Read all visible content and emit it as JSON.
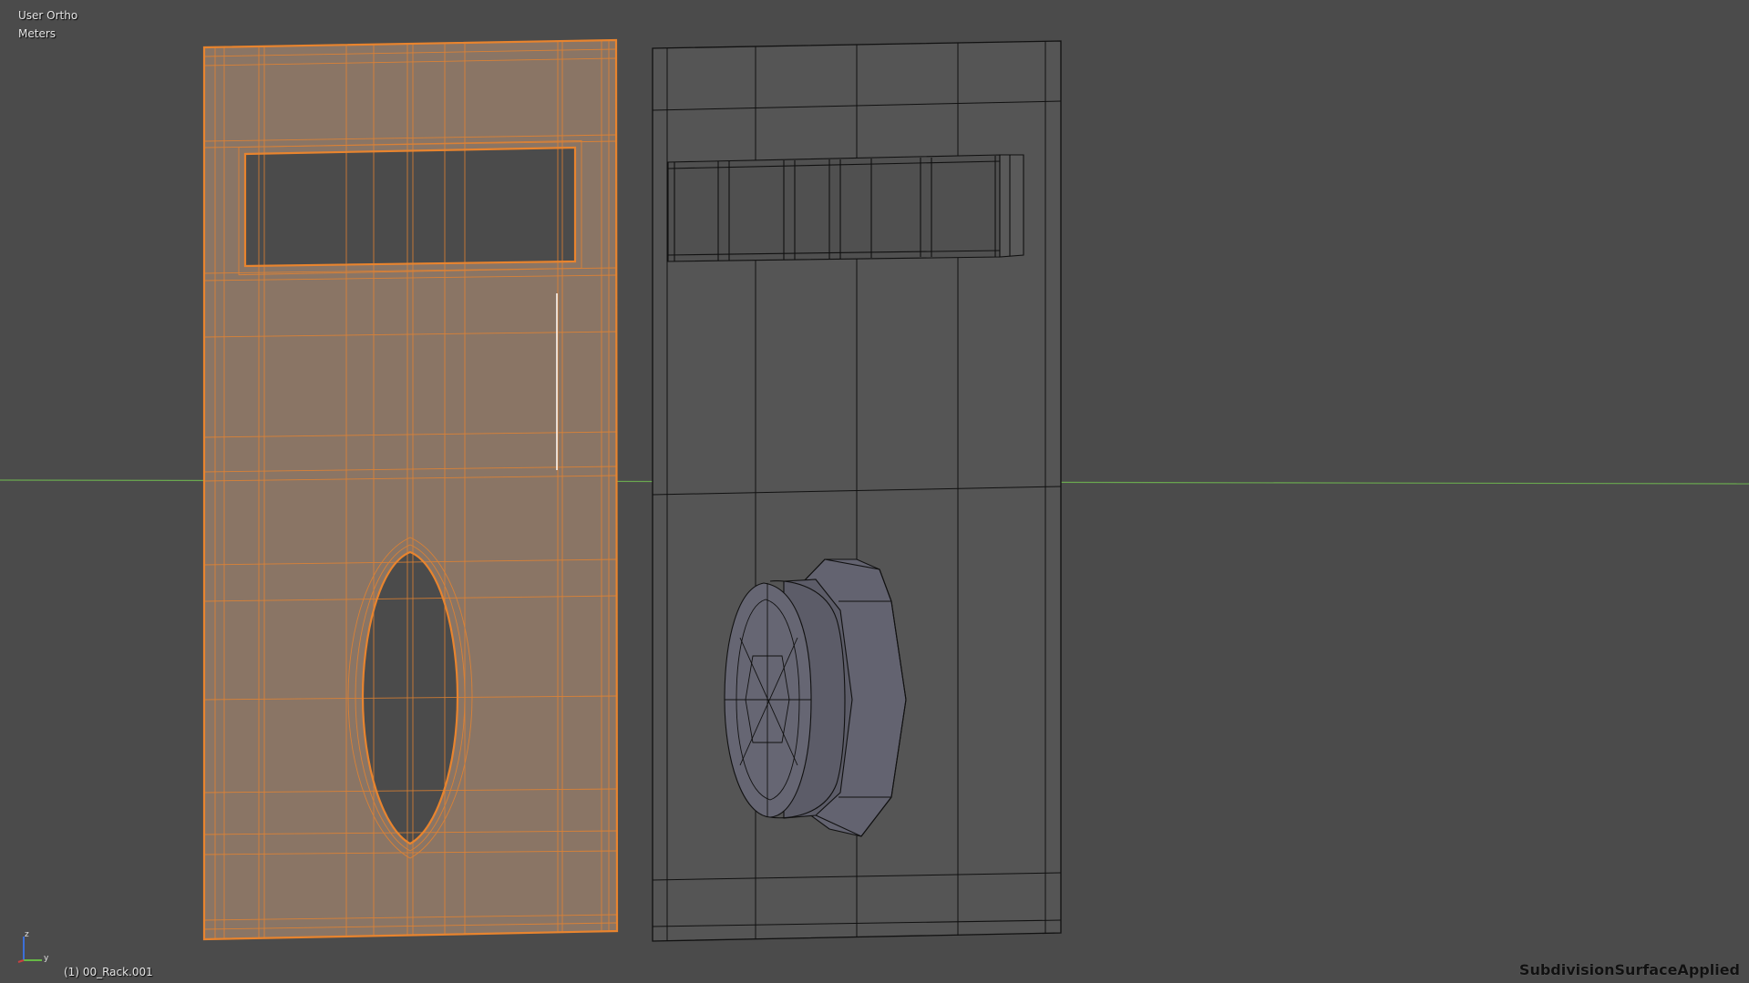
{
  "viewport": {
    "view_type": "User Ortho",
    "units": "Meters",
    "object_info": "(1) 00_Rack.001",
    "modifier_label": "SubdivisionSurfaceApplied"
  },
  "axis_gizmo": {
    "z_label": "z",
    "y_label": "y"
  },
  "colors": {
    "background": "#4b4b4b",
    "selected_wire": "#e8842e",
    "selected_face": "#8a7565",
    "mesh_face": "#555555",
    "mesh_wire": "#111111",
    "horizon_line": "#6aa84f"
  },
  "objects": [
    {
      "name": "selected-panel",
      "selected": true
    },
    {
      "name": "knob-panel",
      "selected": false
    }
  ]
}
